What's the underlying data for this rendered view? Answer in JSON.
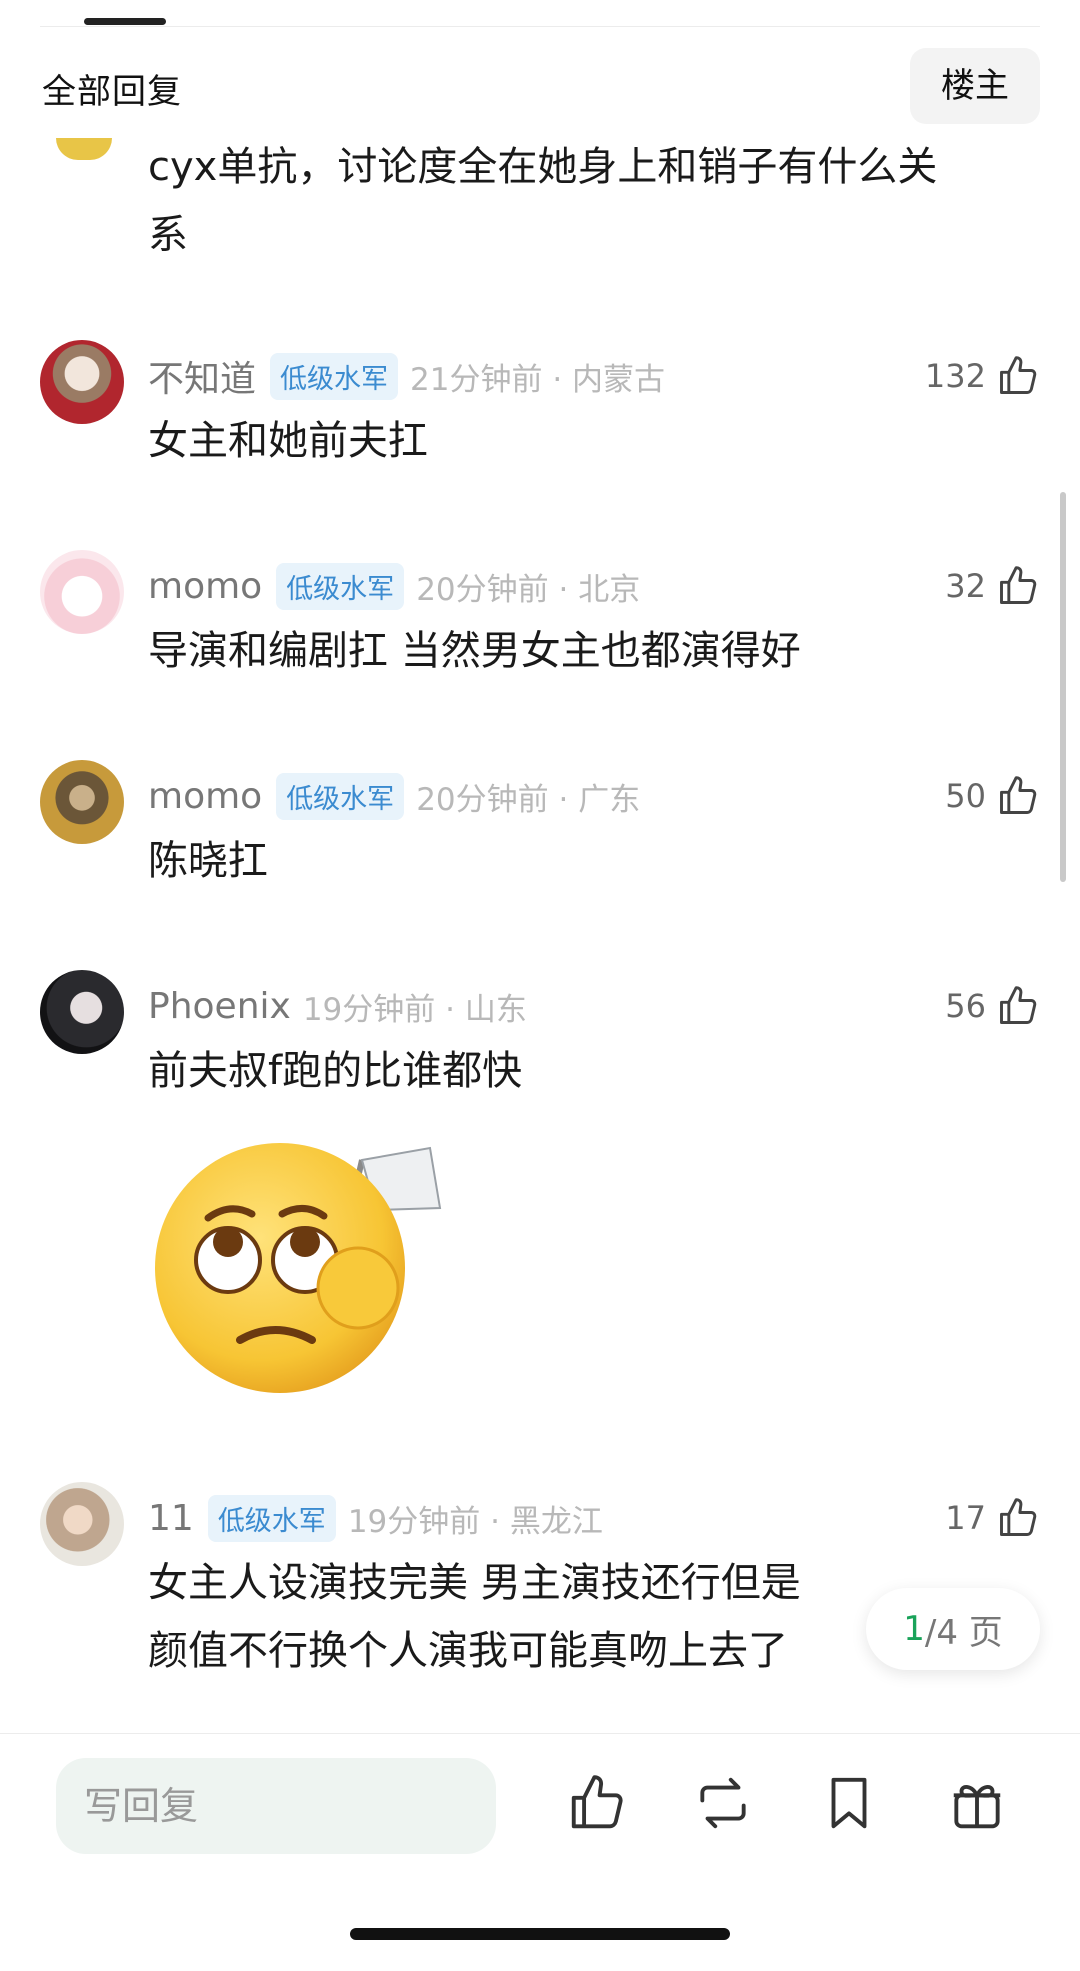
{
  "header": {
    "title": "全部回复",
    "op_button": "楼主"
  },
  "first_comment": {
    "text_line1": "cyx单抗，讨论度全在她身上和销子有什么关",
    "text_line2": "系"
  },
  "comments": [
    {
      "username": "不知道",
      "badge": "低级水军",
      "meta": "21分钟前 · 内蒙古",
      "likes": "132",
      "text": "女主和她前夫扛"
    },
    {
      "username": "momo",
      "badge": "低级水军",
      "meta": "20分钟前 · 北京",
      "likes": "32",
      "text": "导演和编剧扛 当然男女主也都演得好"
    },
    {
      "username": "momo",
      "badge": "低级水军",
      "meta": "20分钟前 · 广东",
      "likes": "50",
      "text": "陈晓扛"
    },
    {
      "username": "Phoenix",
      "badge": "",
      "meta": "19分钟前 · 山东",
      "likes": "56",
      "text": "前夫叔f跑的比谁都快"
    },
    {
      "username": "11",
      "badge": "低级水军",
      "meta": "19分钟前 · 黑龙江",
      "likes": "17",
      "text_line1": "女主人设演技完美 男主演技还行但是",
      "text_line2": "颜值不行换个人演我可能真吻上去了"
    }
  ],
  "pager": {
    "current": "1",
    "total_text": "/4 页"
  },
  "bottom_bar": {
    "reply_placeholder": "写回复"
  },
  "icons": [
    "thumb-up-icon",
    "repost-icon",
    "bookmark-icon",
    "gift-icon"
  ],
  "colors": {
    "badge_text": "#3b8bd0",
    "badge_bg": "#e8f3fb",
    "pager_current": "#1aa35a",
    "reply_bg": "#eef4f1"
  }
}
